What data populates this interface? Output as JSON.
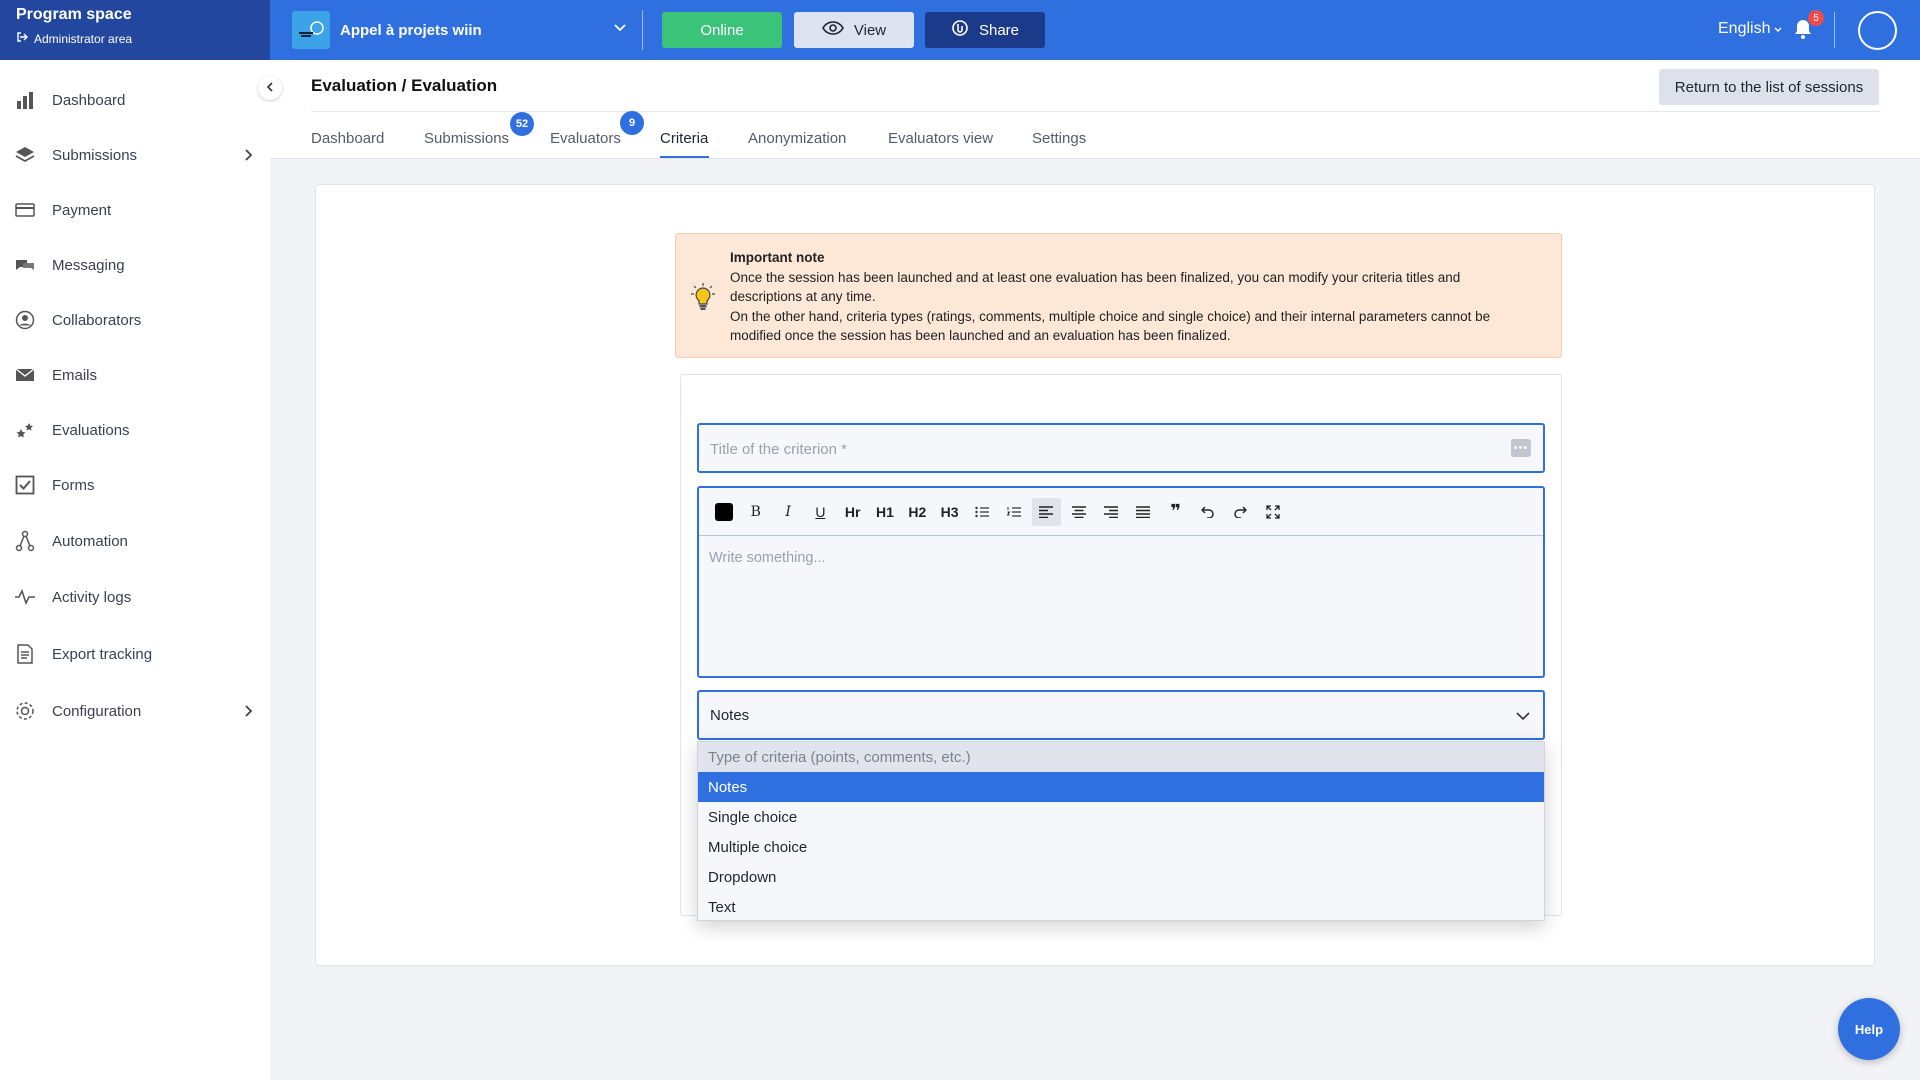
{
  "brand": {
    "title": "Program space",
    "subtitle": "Administrator area"
  },
  "topbar": {
    "project_name": "Appel à projets wiin",
    "online_label": "Online",
    "view_label": "View",
    "share_label": "Share",
    "language": "English",
    "notification_count": "5"
  },
  "sidebar": {
    "items": [
      {
        "label": "Dashboard",
        "icon": "bar-chart-icon"
      },
      {
        "label": "Submissions",
        "icon": "layers-icon"
      },
      {
        "label": "Payment",
        "icon": "credit-card-icon"
      },
      {
        "label": "Messaging",
        "icon": "chat-icon"
      },
      {
        "label": "Collaborators",
        "icon": "user-circle-icon"
      },
      {
        "label": "Emails",
        "icon": "envelope-icon"
      },
      {
        "label": "Evaluations",
        "icon": "stars-icon"
      },
      {
        "label": "Forms",
        "icon": "checkbox-icon"
      },
      {
        "label": "Automation",
        "icon": "automation-icon"
      },
      {
        "label": "Activity logs",
        "icon": "activity-icon"
      },
      {
        "label": "Export tracking",
        "icon": "document-icon"
      },
      {
        "label": "Configuration",
        "icon": "gear-icon"
      }
    ]
  },
  "header": {
    "title": "Evaluation / Evaluation",
    "return_label": "Return to the list of sessions",
    "tabs": [
      {
        "label": "Dashboard"
      },
      {
        "label": "Submissions",
        "badge": "52"
      },
      {
        "label": "Evaluators",
        "badge": "9"
      },
      {
        "label": "Criteria"
      },
      {
        "label": "Anonymization"
      },
      {
        "label": "Evaluators view"
      },
      {
        "label": "Settings"
      }
    ],
    "active_tab": "Criteria"
  },
  "note": {
    "title": "Important note",
    "line1": "Once the session has been launched and at least one evaluation has been finalized, you can modify your criteria titles and descriptions at any time.",
    "line2": "On the other hand, criteria types (ratings, comments, multiple choice and single choice) and their internal parameters cannot be modified once the session has been launched and an evaluation has been finalized."
  },
  "form": {
    "title_placeholder": "Title of the criterion *",
    "editor_placeholder": "Write something...",
    "toolbar": [
      "color",
      "B",
      "I",
      "U",
      "Hr",
      "H1",
      "H2",
      "H3",
      "bullet-list",
      "ordered-list",
      "align-left",
      "align-center",
      "align-right",
      "align-justify",
      "quote",
      "undo",
      "redo",
      "fullscreen"
    ],
    "select_value": "Notes",
    "dropdown": {
      "hint": "Type of criteria (points, comments, etc.)",
      "options": [
        "Notes",
        "Single choice",
        "Multiple choice",
        "Dropdown",
        "Text"
      ],
      "selected": "Notes"
    }
  },
  "help_label": "Help",
  "colors": {
    "primary": "#2f6fe0",
    "brand_dark": "#23479e",
    "online": "#3cc37a",
    "share": "#1c3a8a",
    "note_bg": "#fde8d8"
  }
}
